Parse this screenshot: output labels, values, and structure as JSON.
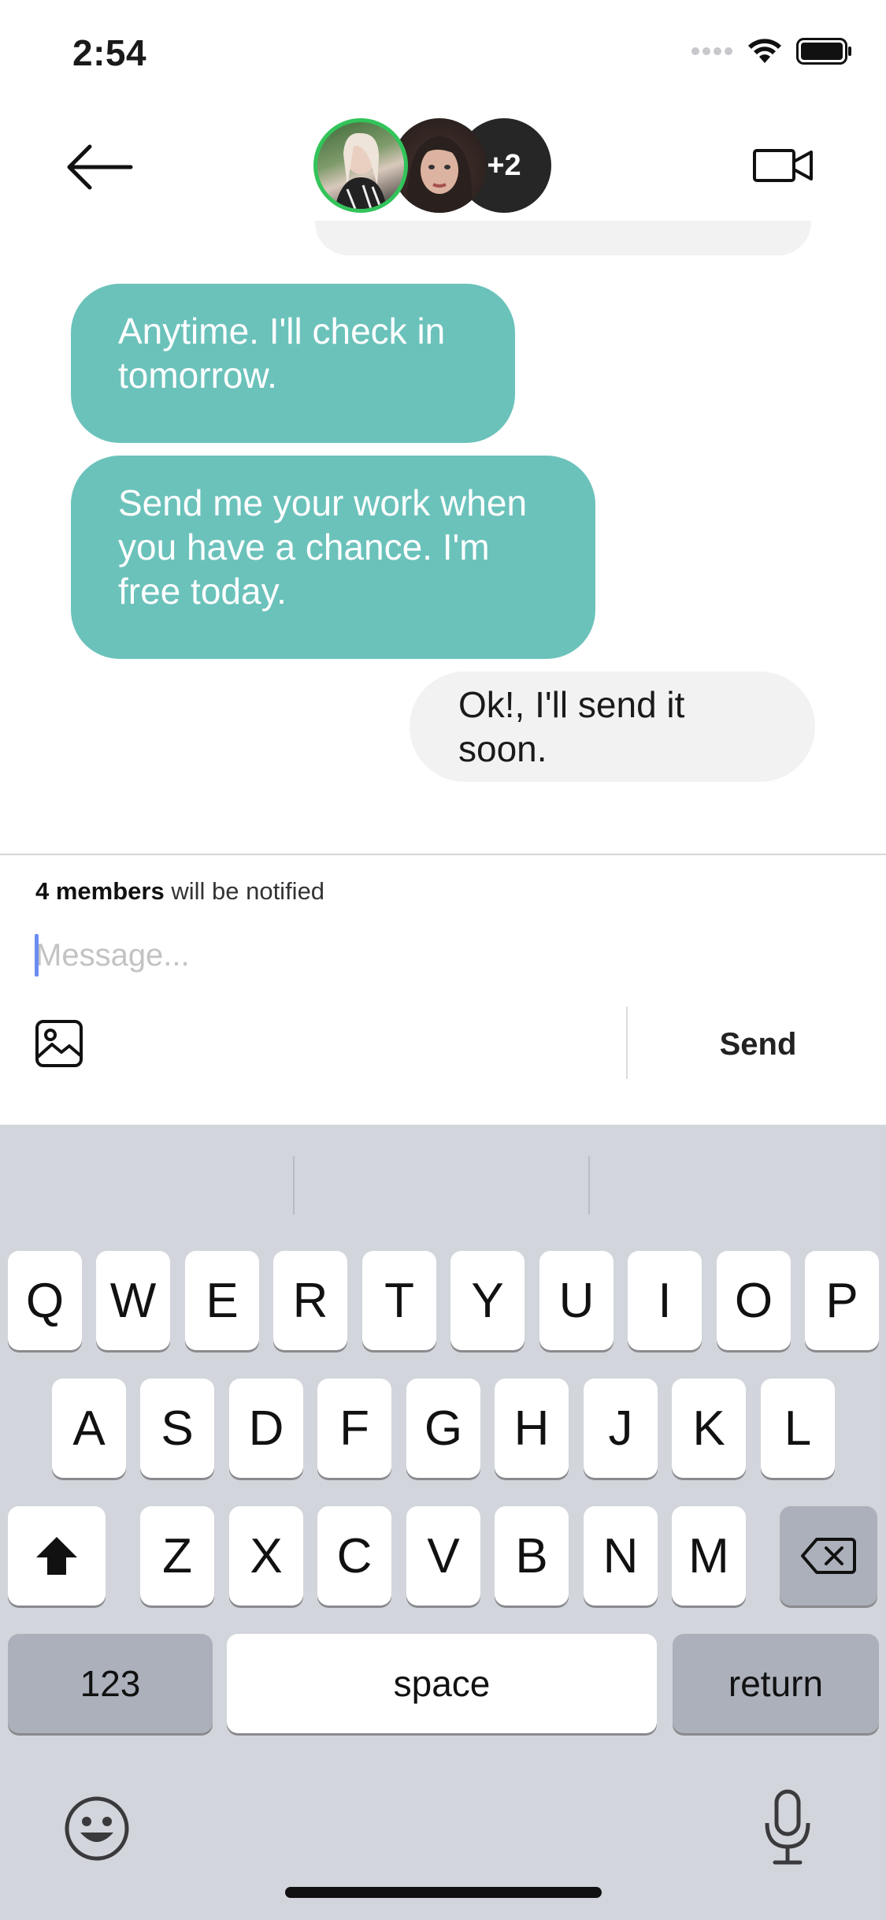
{
  "status_bar": {
    "time": "2:54"
  },
  "header": {
    "more_count": "+2"
  },
  "messages": [
    {
      "from": "them",
      "text": "Anytime. I'll check in tomorrow."
    },
    {
      "from": "them",
      "text": "Send me your work when you have a chance. I'm free today."
    },
    {
      "from": "me",
      "text": "Ok!, I'll send it soon."
    }
  ],
  "composer": {
    "notify_strong": "4 members",
    "notify_rest": " will be notified",
    "placeholder": "Message...",
    "send_label": "Send"
  },
  "keyboard": {
    "row1": [
      "Q",
      "W",
      "E",
      "R",
      "T",
      "Y",
      "U",
      "I",
      "O",
      "P"
    ],
    "row2": [
      "A",
      "S",
      "D",
      "F",
      "G",
      "H",
      "J",
      "K",
      "L"
    ],
    "row3": [
      "Z",
      "X",
      "C",
      "V",
      "B",
      "N",
      "M"
    ],
    "numbers_label": "123",
    "space_label": "space",
    "return_label": "return"
  },
  "colors": {
    "incoming_bubble": "#6bc2bb",
    "outgoing_bubble": "#f2f2f2",
    "online_ring": "#32c45a",
    "caret": "#6b8cf0"
  }
}
